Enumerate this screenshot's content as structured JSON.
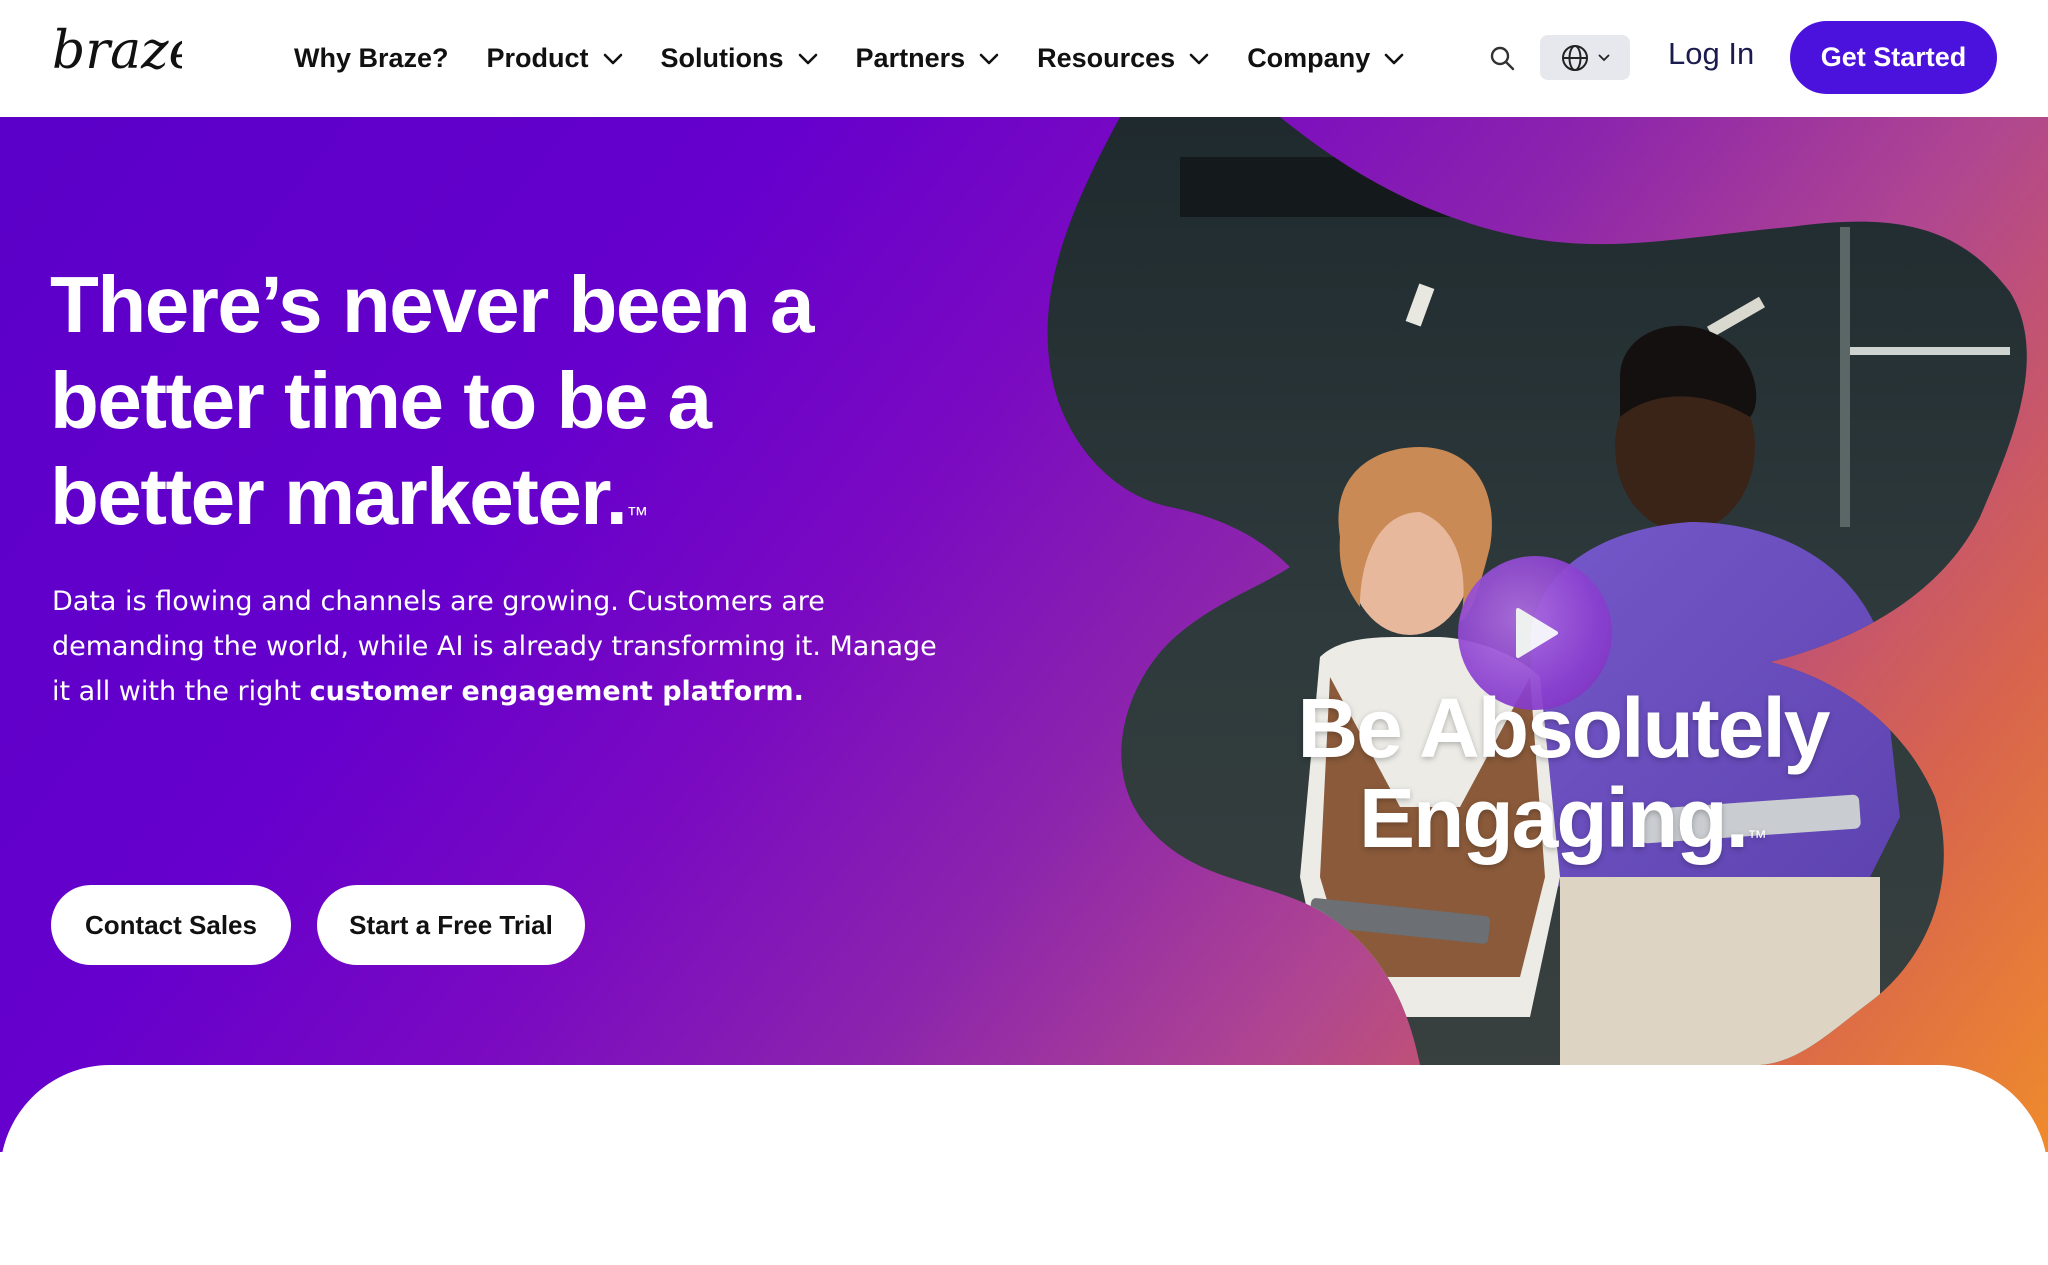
{
  "header": {
    "logo_text": "braze",
    "nav": [
      {
        "label": "Why Braze?",
        "has_dropdown": false
      },
      {
        "label": "Product",
        "has_dropdown": true
      },
      {
        "label": "Solutions",
        "has_dropdown": true
      },
      {
        "label": "Partners",
        "has_dropdown": true
      },
      {
        "label": "Resources",
        "has_dropdown": true
      },
      {
        "label": "Company",
        "has_dropdown": true
      }
    ],
    "search_icon": "search-icon",
    "language_icon": "globe-icon",
    "login_label": "Log In",
    "cta_label": "Get Started"
  },
  "hero": {
    "title_line1": "There’s never been a",
    "title_line2": "better time to be a",
    "title_line3": "better marketer.",
    "title_tm": "™",
    "description_plain": "Data is flowing and channels are growing. Customers are demanding the world, while AI is already transforming it. Manage it all with the right ",
    "description_bold": "customer engagement platform.",
    "primary_button": "Contact Sales",
    "secondary_button": "Start a Free Trial",
    "video": {
      "caption_line1": "Be Absolutely",
      "caption_line2": "Engaging.",
      "caption_tm": "™",
      "play_icon": "play-icon"
    }
  },
  "colors": {
    "brand_purple": "#4b12dd",
    "hero_gradient_start": "#5a00c8",
    "hero_gradient_end": "#ef8b2c",
    "text_dark": "#111111"
  }
}
